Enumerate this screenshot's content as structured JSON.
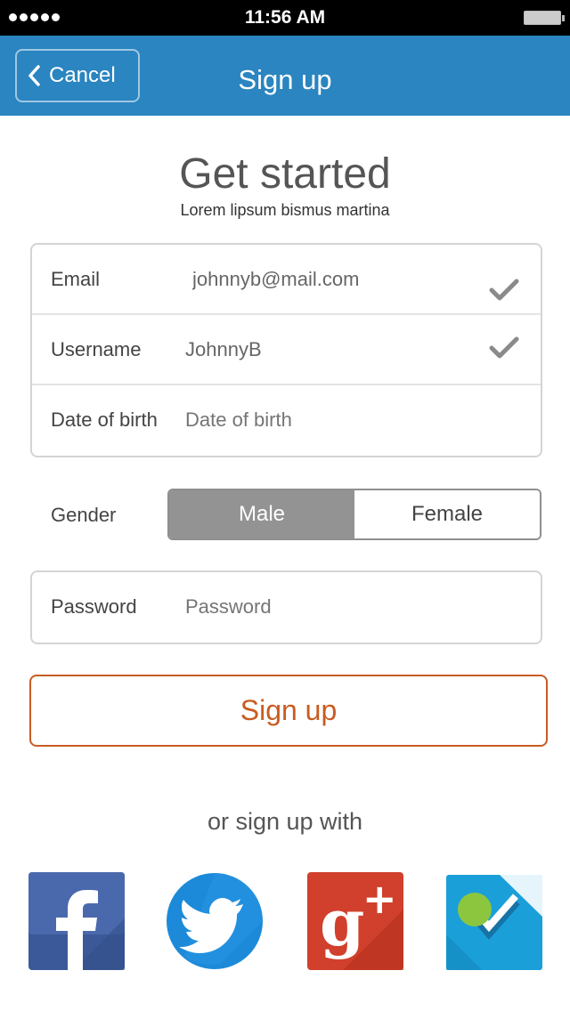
{
  "status_bar": {
    "time": "11:56 AM"
  },
  "nav": {
    "cancel_label": "Cancel",
    "title": "Sign up"
  },
  "header": {
    "title": "Get started",
    "subtitle": "Lorem lipsum bismus martina"
  },
  "form": {
    "email": {
      "label": "Email",
      "value": "johnnyb@mail.com",
      "valid": true
    },
    "username": {
      "label": "Username",
      "value": "JohnnyB",
      "valid": true
    },
    "dob": {
      "label": "Date of birth",
      "value": "",
      "placeholder": "Date of birth"
    },
    "gender": {
      "label": "Gender",
      "options": [
        "Male",
        "Female"
      ],
      "selected": "Male"
    },
    "password": {
      "label": "Password",
      "value": "",
      "placeholder": "Password"
    }
  },
  "signup_button": {
    "label": "Sign up"
  },
  "social": {
    "heading": "or sign up with",
    "providers": [
      "facebook-icon",
      "twitter-icon",
      "google-plus-icon",
      "foursquare-icon"
    ]
  },
  "colors": {
    "nav_bar": "#2a85c0",
    "accent": "#c85c22",
    "segment_selected": "#939393"
  }
}
